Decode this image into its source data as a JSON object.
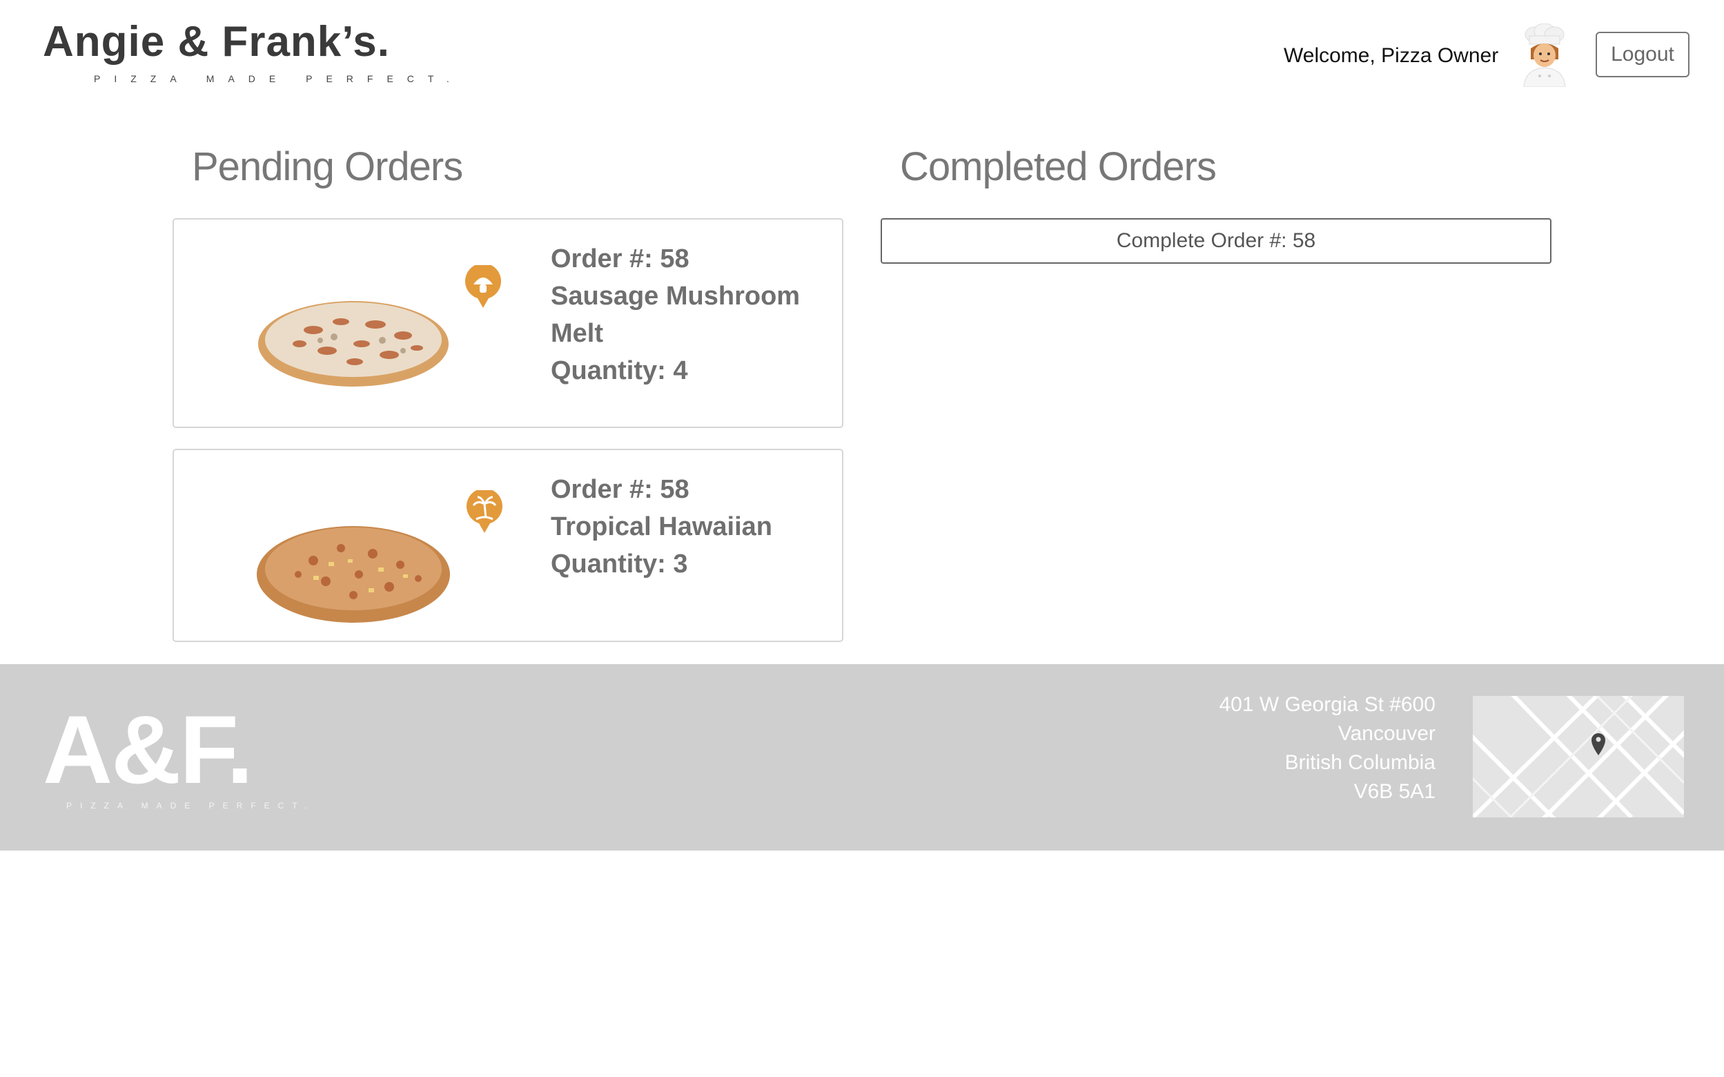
{
  "header": {
    "logo_title": "Angie & Frank’s.",
    "logo_tagline": "PIZZA MADE PERFECT.",
    "welcome_text": "Welcome, Pizza Owner",
    "logout_label": "Logout"
  },
  "pending": {
    "heading": "Pending Orders",
    "orders": [
      {
        "order_label": "Order #: 58",
        "name_line1": "Sausage Mushroom",
        "name_line2": "Melt",
        "quantity_label": "Quantity: 4",
        "topping_icon": "mushroom-icon"
      },
      {
        "order_label": "Order #: 58",
        "name_line1": "Tropical Hawaiian",
        "quantity_label": "Quantity: 3",
        "topping_icon": "palm-tree-icon"
      }
    ]
  },
  "completed": {
    "heading": "Completed Orders",
    "items": [
      {
        "label": "Complete Order #: 58"
      }
    ]
  },
  "footer": {
    "logo_text": "A&F.",
    "logo_tagline": "PIZZA MADE PERFECT.",
    "address_line1": "401 W Georgia St #600",
    "address_line2": "Vancouver",
    "address_line3": "British Columbia",
    "address_line4": "V6B 5A1"
  },
  "colors": {
    "badge_orange": "#e39a3b",
    "footer_bg": "#cfcfcf",
    "heading_gray": "#777777"
  }
}
